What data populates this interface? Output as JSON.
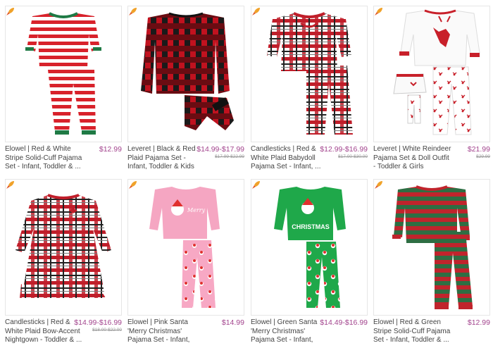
{
  "colors": {
    "price": "#a3458e",
    "rocket": "#f0a22a",
    "rocket_flame": "#e05a2a"
  },
  "products": [
    {
      "title": "Elowel | Red & White Stripe Solid-Cuff Pajama Set - Infant, Toddler & ...",
      "price": "$12.99",
      "original_price": ""
    },
    {
      "title": "Leveret | Black & Red Plaid Pajama Set - Infant, Toddler & Kids",
      "price": "$14.99-$17.99",
      "original_price": "$17.99-$22.99"
    },
    {
      "title": "Candlesticks | Red & White Plaid Babydoll Pajama Set - Infant, ...",
      "price": "$12.99-$16.99",
      "original_price": "$17.00-$30.00"
    },
    {
      "title": "Leveret | White Reindeer Pajama Set & Doll Outfit - Toddler & Girls",
      "price": "$21.99",
      "original_price": "$29.99"
    },
    {
      "title": "Candlesticks | Red & White Plaid Bow-Accent Nightgown - Toddler & ...",
      "price": "$14.99-$16.99",
      "original_price": "$18.00-$22.00"
    },
    {
      "title": "Elowel | Pink Santa 'Merry Christmas' Pajama Set - Infant, Toddler & ...",
      "price": "$14.99",
      "original_price": ""
    },
    {
      "title": "Elowel | Green Santa 'Merry Christmas' Pajama Set - Infant, Toddler & ...",
      "price": "$14.49-$16.99",
      "original_price": ""
    },
    {
      "title": "Elowel | Red & Green Stripe Solid-Cuff Pajama Set - Infant, Toddler & ...",
      "price": "$12.99",
      "original_price": ""
    }
  ],
  "images": {
    "p2_shirt_text": "CHRISTMAS"
  }
}
